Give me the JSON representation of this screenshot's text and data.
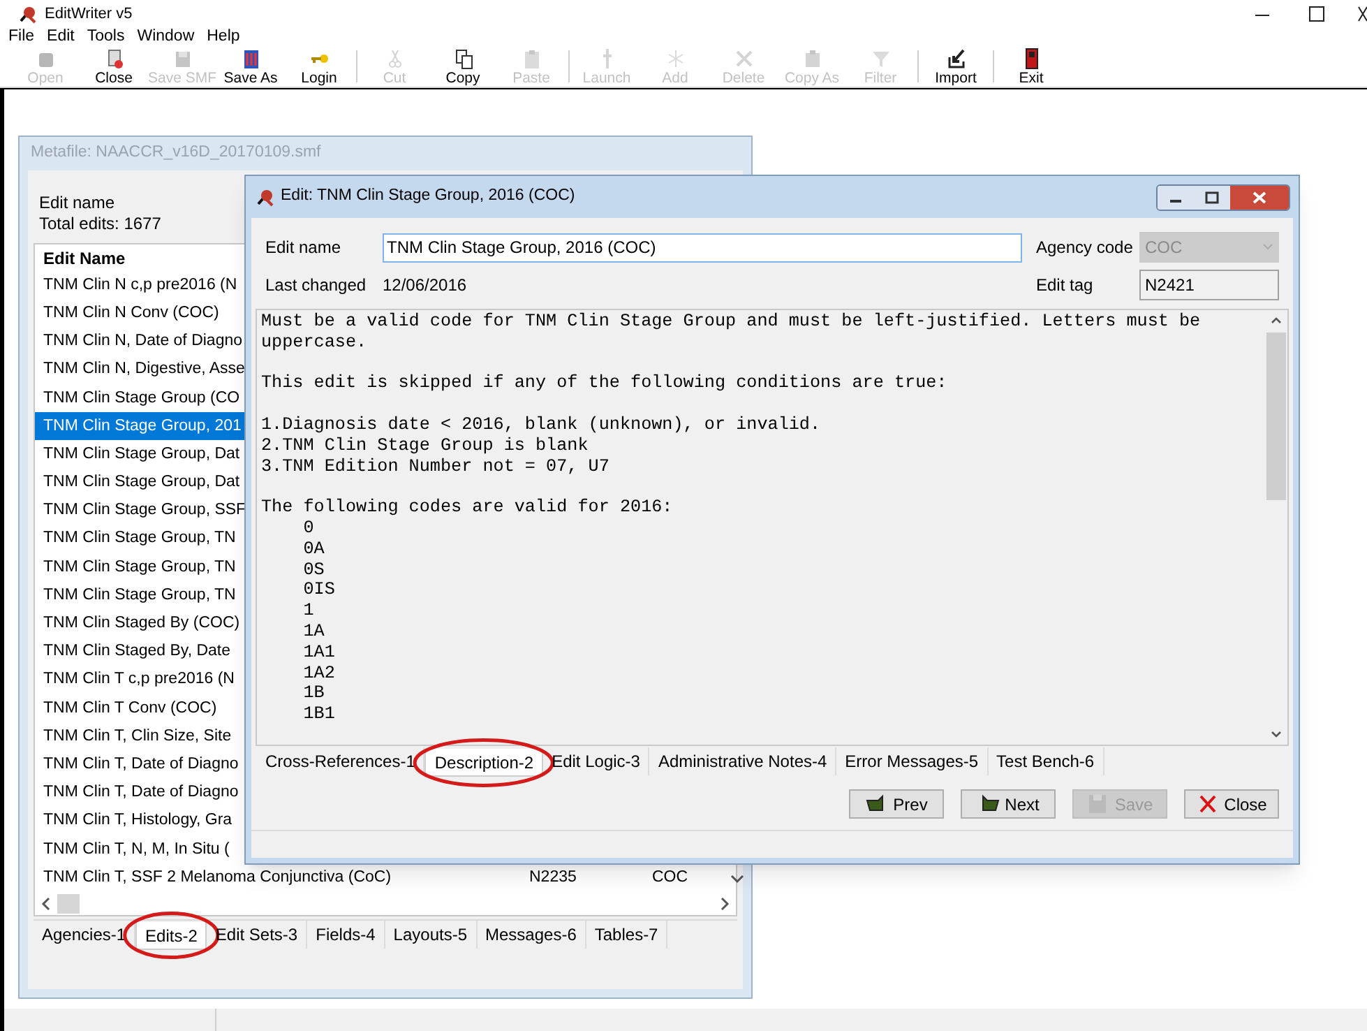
{
  "window": {
    "title": "EditWriter v5"
  },
  "menu": [
    "File",
    "Edit",
    "Tools",
    "Window",
    "Help"
  ],
  "toolbar": [
    [
      {
        "label": "Open",
        "disabled": true
      },
      {
        "label": "Close",
        "disabled": false
      },
      {
        "label": "Save SMF",
        "disabled": true
      },
      {
        "label": "Save As",
        "disabled": false
      },
      {
        "label": "Login",
        "disabled": false
      }
    ],
    [
      {
        "label": "Cut",
        "disabled": true
      },
      {
        "label": "Copy",
        "disabled": false
      },
      {
        "label": "Paste",
        "disabled": true
      }
    ],
    [
      {
        "label": "Launch",
        "disabled": true
      },
      {
        "label": "Add",
        "disabled": true
      },
      {
        "label": "Delete",
        "disabled": true
      },
      {
        "label": "Copy As",
        "disabled": true
      },
      {
        "label": "Filter",
        "disabled": true
      }
    ],
    [
      {
        "label": "Import",
        "disabled": false
      }
    ],
    [
      {
        "label": "Exit",
        "disabled": false
      }
    ]
  ],
  "metafile_window": {
    "title": "Metafile: NAACCR_v16D_20170109.smf",
    "edit_name_label": "Edit name",
    "total_edits": "Total edits: 1677",
    "table": {
      "columns": [
        "Edit Name"
      ],
      "rows": [
        {
          "cells": [
            "TNM Clin N c,p pre2016 (N"
          ],
          "selected": false
        },
        {
          "cells": [
            "TNM Clin N Conv (COC)"
          ],
          "selected": false
        },
        {
          "cells": [
            "TNM Clin N, Date of Diagno"
          ],
          "selected": false
        },
        {
          "cells": [
            "TNM Clin N, Digestive, Asse"
          ],
          "selected": false
        },
        {
          "cells": [
            "TNM Clin Stage Group (CO"
          ],
          "selected": false
        },
        {
          "cells": [
            "TNM Clin Stage Group, 201"
          ],
          "selected": true
        },
        {
          "cells": [
            "TNM Clin Stage Group, Dat"
          ],
          "selected": false
        },
        {
          "cells": [
            "TNM Clin Stage Group, Dat"
          ],
          "selected": false
        },
        {
          "cells": [
            "TNM Clin Stage Group, SSF"
          ],
          "selected": false
        },
        {
          "cells": [
            "TNM Clin Stage Group, TN"
          ],
          "selected": false
        },
        {
          "cells": [
            "TNM Clin Stage Group, TN"
          ],
          "selected": false
        },
        {
          "cells": [
            "TNM Clin Stage Group, TN"
          ],
          "selected": false
        },
        {
          "cells": [
            "TNM Clin Staged By (COC)"
          ],
          "selected": false
        },
        {
          "cells": [
            "TNM Clin Staged By, Date"
          ],
          "selected": false
        },
        {
          "cells": [
            "TNM Clin T c,p pre2016 (N"
          ],
          "selected": false
        },
        {
          "cells": [
            "TNM Clin T Conv (COC)"
          ],
          "selected": false
        },
        {
          "cells": [
            "TNM Clin T, Clin Size, Site"
          ],
          "selected": false
        },
        {
          "cells": [
            "TNM Clin T, Date of Diagno"
          ],
          "selected": false
        },
        {
          "cells": [
            "TNM Clin T, Date of Diagno"
          ],
          "selected": false
        },
        {
          "cells": [
            "TNM Clin T, Histology, Gra"
          ],
          "selected": false
        },
        {
          "cells": [
            "TNM Clin T, N, M, In Situ ("
          ],
          "selected": false
        },
        {
          "cells": [
            "TNM Clin T, SSF 2 Melanoma Conjunctiva (CoC)",
            "N2235",
            "COC"
          ],
          "selected": false
        }
      ]
    },
    "tabs": [
      {
        "label": "Agencies-1",
        "selected": false,
        "circled": false
      },
      {
        "label": "Edits-2",
        "selected": true,
        "circled": true
      },
      {
        "label": "Edit Sets-3",
        "selected": false,
        "circled": false
      },
      {
        "label": "Fields-4",
        "selected": false,
        "circled": false
      },
      {
        "label": "Layouts-5",
        "selected": false,
        "circled": false
      },
      {
        "label": "Messages-6",
        "selected": false,
        "circled": false
      },
      {
        "label": "Tables-7",
        "selected": false,
        "circled": false
      }
    ]
  },
  "edit_dialog": {
    "title": "Edit: TNM Clin Stage Group, 2016 (COC)",
    "edit_name_label": "Edit name",
    "edit_name_value": "TNM Clin Stage Group, 2016 (COC)",
    "agency_code_label": "Agency code",
    "agency_code_value": "COC",
    "agency_code_disabled": true,
    "last_changed_label": "Last changed",
    "last_changed_value": "12/06/2016",
    "edit_tag_label": "Edit tag",
    "edit_tag_value": "N2421",
    "description": "Must be a valid code for TNM Clin Stage Group and must be left-justified. Letters must be uppercase.\n\nThis edit is skipped if any of the following conditions are true:\n\n1.Diagnosis date < 2016, blank (unknown), or invalid.\n2.TNM Clin Stage Group is blank\n3.TNM Edition Number not = 07, U7\n\nThe following codes are valid for 2016:\n    0\n    0A\n    0S\n    0IS\n    1\n    1A\n    1A1\n    1A2\n    1B\n    1B1",
    "tabs": [
      {
        "label": "Cross-References-1",
        "selected": false,
        "circled": false
      },
      {
        "label": "Description-2",
        "selected": true,
        "circled": true
      },
      {
        "label": "Edit Logic-3",
        "selected": false,
        "circled": false
      },
      {
        "label": "Administrative Notes-4",
        "selected": false,
        "circled": false
      },
      {
        "label": "Error Messages-5",
        "selected": false,
        "circled": false
      },
      {
        "label": "Test Bench-6",
        "selected": false,
        "circled": false
      }
    ],
    "buttons": [
      {
        "label": "Prev",
        "disabled": false
      },
      {
        "label": "Next",
        "disabled": false
      },
      {
        "label": "Save",
        "disabled": true
      },
      {
        "label": "Close",
        "disabled": false
      }
    ]
  }
}
